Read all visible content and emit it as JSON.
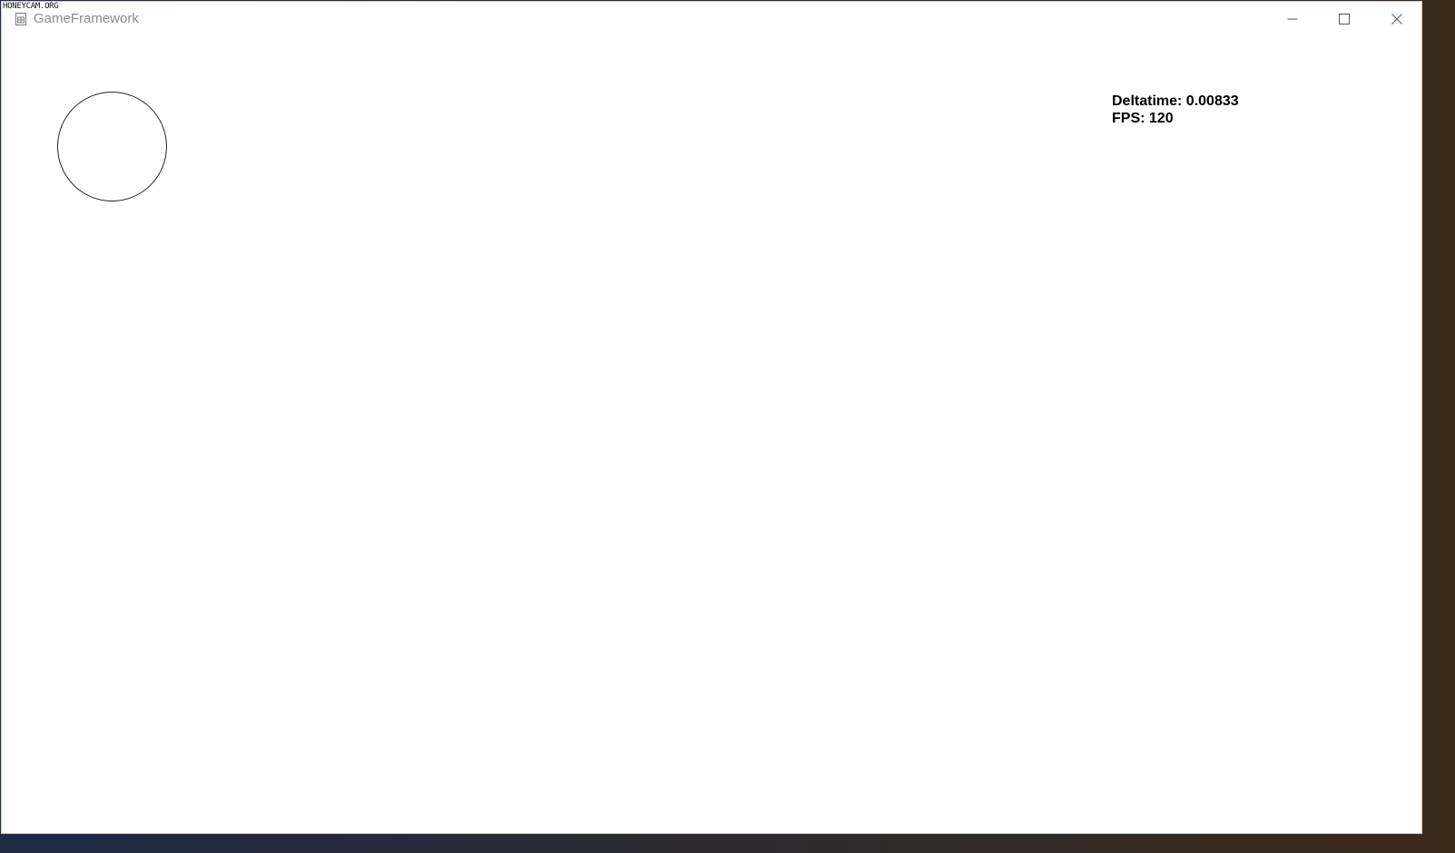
{
  "window": {
    "title": "GameFramework",
    "minimize_icon": "minimize-icon",
    "maximize_icon": "maximize-icon",
    "close_icon": "close-icon"
  },
  "game": {
    "shape": "circle-outline",
    "stats": {
      "deltatime": "Deltatime: 0.00833",
      "fps": "FPS: 120"
    }
  },
  "watermark": {
    "text": "HONEYCAM.ORG"
  },
  "colors": {
    "background": "#ffffff",
    "title_text": "#8a8a8a",
    "stroke": "#222222"
  }
}
